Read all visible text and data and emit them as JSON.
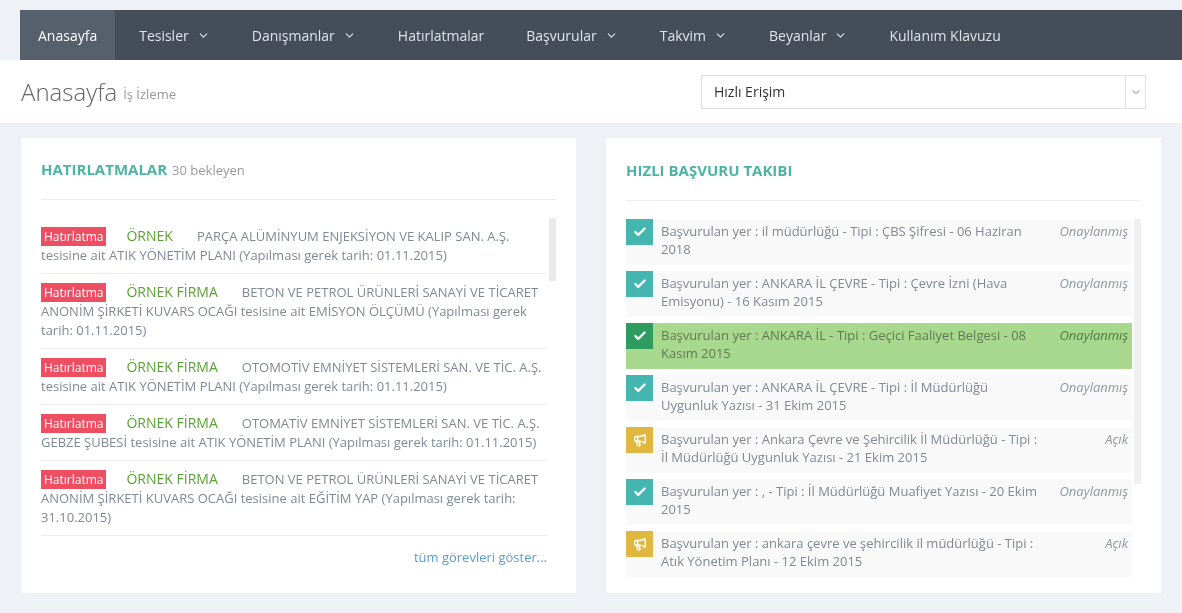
{
  "nav": [
    {
      "label": "Anasayfa",
      "selected": true,
      "dropdown": false
    },
    {
      "label": "Tesisler",
      "selected": false,
      "dropdown": true
    },
    {
      "label": "Danışmanlar",
      "selected": false,
      "dropdown": true
    },
    {
      "label": "Hatırlatmalar",
      "selected": false,
      "dropdown": false
    },
    {
      "label": "Başvurular",
      "selected": false,
      "dropdown": true
    },
    {
      "label": "Takvim",
      "selected": false,
      "dropdown": true
    },
    {
      "label": "Beyanlar",
      "selected": false,
      "dropdown": true
    },
    {
      "label": "Kullanım Klavuzu",
      "selected": false,
      "dropdown": false
    }
  ],
  "page_header": {
    "title": "Anasayfa",
    "subtitle": "İş İzleme",
    "quick_access": {
      "value": "Hızlı Erişim"
    }
  },
  "reminders": {
    "title": "HATIRLATMALAR",
    "count": "30 bekleyen",
    "items": [
      {
        "badge": "Hatırlatma",
        "firm": "ÖRNEK",
        "text": "PARÇA ALÜMİNYUM ENJEKSİYON VE KALIP SAN. A.Ş. tesisine ait ATIK YÖNETİM PLANI (Yapılması gerek tarih: 01.11.2015)"
      },
      {
        "badge": "Hatırlatma",
        "firm": "ÖRNEK FİRMA",
        "text": "BETON VE PETROL ÜRÜNLERİ SANAYİ VE TİCARET ANONİM ŞİRKETİ KUVARS OCAĞI tesisine ait EMİSYON ÖLÇÜMÜ (Yapılması gerek tarih: 01.11.2015)"
      },
      {
        "badge": "Hatırlatma",
        "firm": "ÖRNEK FİRMA",
        "text": "OTOMOTİV EMNİYET SİSTEMLERİ SAN. VE TİC. A.Ş. tesisine ait ATIK YÖNETİM PLANI (Yapılması gerek tarih: 01.11.2015)"
      },
      {
        "badge": "Hatırlatma",
        "firm": "ÖRNEK FİRMA",
        "text": "OTOMATİV EMNİYET SİSTEMLERİ SAN. VE TİC. A.Ş. GEBZE ŞUBESİ tesisine ait ATIK YÖNETİM PLANI (Yapılması gerek tarih: 01.11.2015)"
      },
      {
        "badge": "Hatırlatma",
        "firm": "ÖRNEK FİRMA",
        "text": "BETON VE PETROL ÜRÜNLERİ SANAYİ VE TİCARET ANONİM ŞİRKETİ KUVARS OCAĞI tesisine ait EĞİTİM YAP (Yapılması gerek tarih: 31.10.2015)"
      }
    ],
    "show_all": "tüm görevleri göster..."
  },
  "applications": {
    "title": "HIZLI BAŞVURU TAKIBI",
    "items": [
      {
        "kind": "approved",
        "text": "Başvurulan yer : il müdürlüğü - Tipi : ÇBS Şifresi - 06 Haziran 2018",
        "status": "Onaylanmış",
        "selected": false
      },
      {
        "kind": "approved",
        "text": "Başvurulan yer : ANKARA İL ÇEVRE - Tipi : Çevre İzni (Hava Emisyonu) - 16 Kasım 2015",
        "status": "Onaylanmış",
        "selected": false
      },
      {
        "kind": "approved",
        "text": "Başvurulan yer : ANKARA İL - Tipi : Geçici Faaliyet Belgesi - 08 Kasım 2015",
        "status": "Onaylanmış",
        "selected": true
      },
      {
        "kind": "approved",
        "text": "Başvurulan yer : ANKARA İL ÇEVRE - Tipi : İl Müdürlüğü Uygunluk Yazısı - 31 Ekim 2015",
        "status": "Onaylanmış",
        "selected": false
      },
      {
        "kind": "open",
        "text": "Başvurulan yer : Ankara Çevre ve Şehircilik İl Müdürlüğü - Tipi : İl Müdürlüğü Uygunluk Yazısı - 21 Ekim 2015",
        "status": "Açık",
        "selected": false
      },
      {
        "kind": "approved",
        "text": "Başvurulan yer : , - Tipi : İl Müdürlüğü Muafiyet Yazısı - 20 Ekim 2015",
        "status": "Onaylanmış",
        "selected": false
      },
      {
        "kind": "open",
        "text": "Başvurulan yer : ankara çevre ve şehircilik il müdürlüğü - Tipi : Atık Yönetim Planı - 12 Ekim 2015",
        "status": "Açık",
        "selected": false
      }
    ]
  }
}
